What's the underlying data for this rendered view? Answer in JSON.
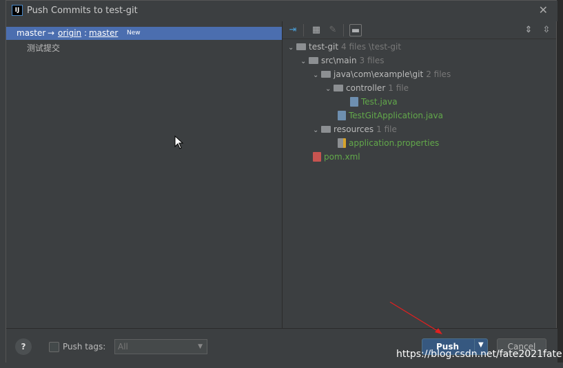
{
  "dialog": {
    "title": "Push Commits to test-git",
    "icon_text": "IJ"
  },
  "left": {
    "branch": {
      "local": "master",
      "arrow": "→",
      "remote": "origin",
      "sep": ":",
      "remote_branch": "master",
      "badge": "New"
    },
    "commits": [
      "测试提交"
    ]
  },
  "toolbar": {
    "icons": [
      "commit-graph-icon",
      "group-by-icon",
      "edit-icon",
      "diff-icon",
      "expand-all-icon",
      "collapse-all-icon"
    ]
  },
  "tree": {
    "root": {
      "name": "test-git",
      "count": "4 files",
      "path": "\\test-git"
    },
    "src": {
      "name": "src\\main",
      "count": "3 files"
    },
    "pkg": {
      "name": "java\\com\\example\\git",
      "count": "2 files"
    },
    "controller": {
      "name": "controller",
      "count": "1 file"
    },
    "test_java": {
      "name": "Test.java"
    },
    "app_java": {
      "name": "TestGitApplication.java"
    },
    "resources": {
      "name": "resources",
      "count": "1 file"
    },
    "props": {
      "name": "application.properties"
    },
    "pom": {
      "name": "pom.xml"
    }
  },
  "footer": {
    "help": "?",
    "push_tags_label": "Push tags:",
    "tags_value": "All",
    "push_label": "Push",
    "cancel_label": "Cancel"
  },
  "watermark": "https://blog.csdn.net/fate2021fate"
}
